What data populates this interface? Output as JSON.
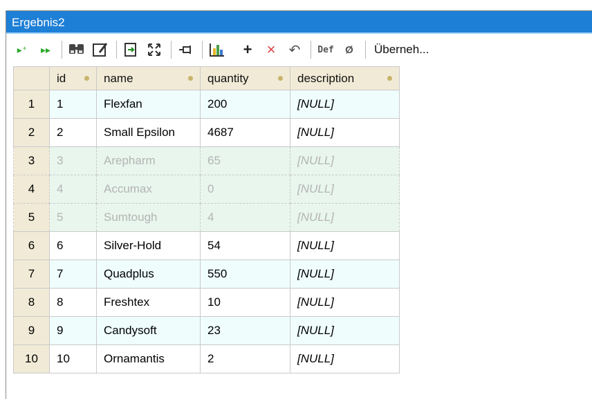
{
  "window": {
    "title": "Ergebnis2"
  },
  "toolbar": {
    "icons": [
      {
        "name": "append-row-icon",
        "glyph": "▸⁺",
        "color": "#2aa82a"
      },
      {
        "name": "append-rows-icon",
        "glyph": "▸▸",
        "color": "#2aa82a"
      },
      {
        "name": "find-icon",
        "glyph": "🔎",
        "color": "#333333"
      },
      {
        "name": "edit-data-icon",
        "glyph": "✎",
        "color": "#333333"
      },
      {
        "name": "export-icon",
        "glyph": "⎘",
        "color": "#1b8a1b"
      },
      {
        "name": "maximize-icon",
        "glyph": "⤧",
        "color": "#333333"
      },
      {
        "name": "pin-icon",
        "glyph": "⊣",
        "color": "#333333"
      },
      {
        "name": "chart-icon",
        "glyph": "▥",
        "color": "#d4a017"
      },
      {
        "name": "add-row-icon",
        "glyph": "+",
        "color": "#222222"
      },
      {
        "name": "delete-row-icon",
        "glyph": "×",
        "color": "#e04040"
      },
      {
        "name": "undo-changes-icon",
        "glyph": "↶",
        "color": "#555555"
      },
      {
        "name": "set-default-icon",
        "glyph": "Def",
        "color": "#555555"
      },
      {
        "name": "set-null-icon",
        "glyph": "Ø",
        "color": "#555555"
      }
    ],
    "commit_label": "Überneh..."
  },
  "grid": {
    "columns": [
      "id",
      "name",
      "quantity",
      "description"
    ],
    "rows": [
      {
        "num": "1",
        "id": "1",
        "name": "Flexfan",
        "quantity": "200",
        "description": "[NULL]"
      },
      {
        "num": "2",
        "id": "2",
        "name": "Small Epsilon",
        "quantity": "4687",
        "description": "[NULL]"
      },
      {
        "num": "3",
        "id": "3",
        "name": "Arepharm",
        "quantity": "65",
        "description": "[NULL]"
      },
      {
        "num": "4",
        "id": "4",
        "name": "Accumax",
        "quantity": "0",
        "description": "[NULL]"
      },
      {
        "num": "5",
        "id": "5",
        "name": "Sumtough",
        "quantity": "4",
        "description": "[NULL]"
      },
      {
        "num": "6",
        "id": "6",
        "name": "Silver-Hold",
        "quantity": "54",
        "description": "[NULL]"
      },
      {
        "num": "7",
        "id": "7",
        "name": "Quadplus",
        "quantity": "550",
        "description": "[NULL]"
      },
      {
        "num": "8",
        "id": "8",
        "name": "Freshtex",
        "quantity": "10",
        "description": "[NULL]"
      },
      {
        "num": "9",
        "id": "9",
        "name": "Candysoft",
        "quantity": "23",
        "description": "[NULL]"
      },
      {
        "num": "10",
        "id": "10",
        "name": "Ornamantis",
        "quantity": "2",
        "description": "[NULL]"
      }
    ],
    "disabled_rows": [
      3,
      4,
      5
    ]
  },
  "colors": {
    "title_bar": "#1e7fd6",
    "header_bg": "#f1ead6",
    "row_tint": "#effdfd",
    "disabled_row": "#e8f6ee"
  }
}
